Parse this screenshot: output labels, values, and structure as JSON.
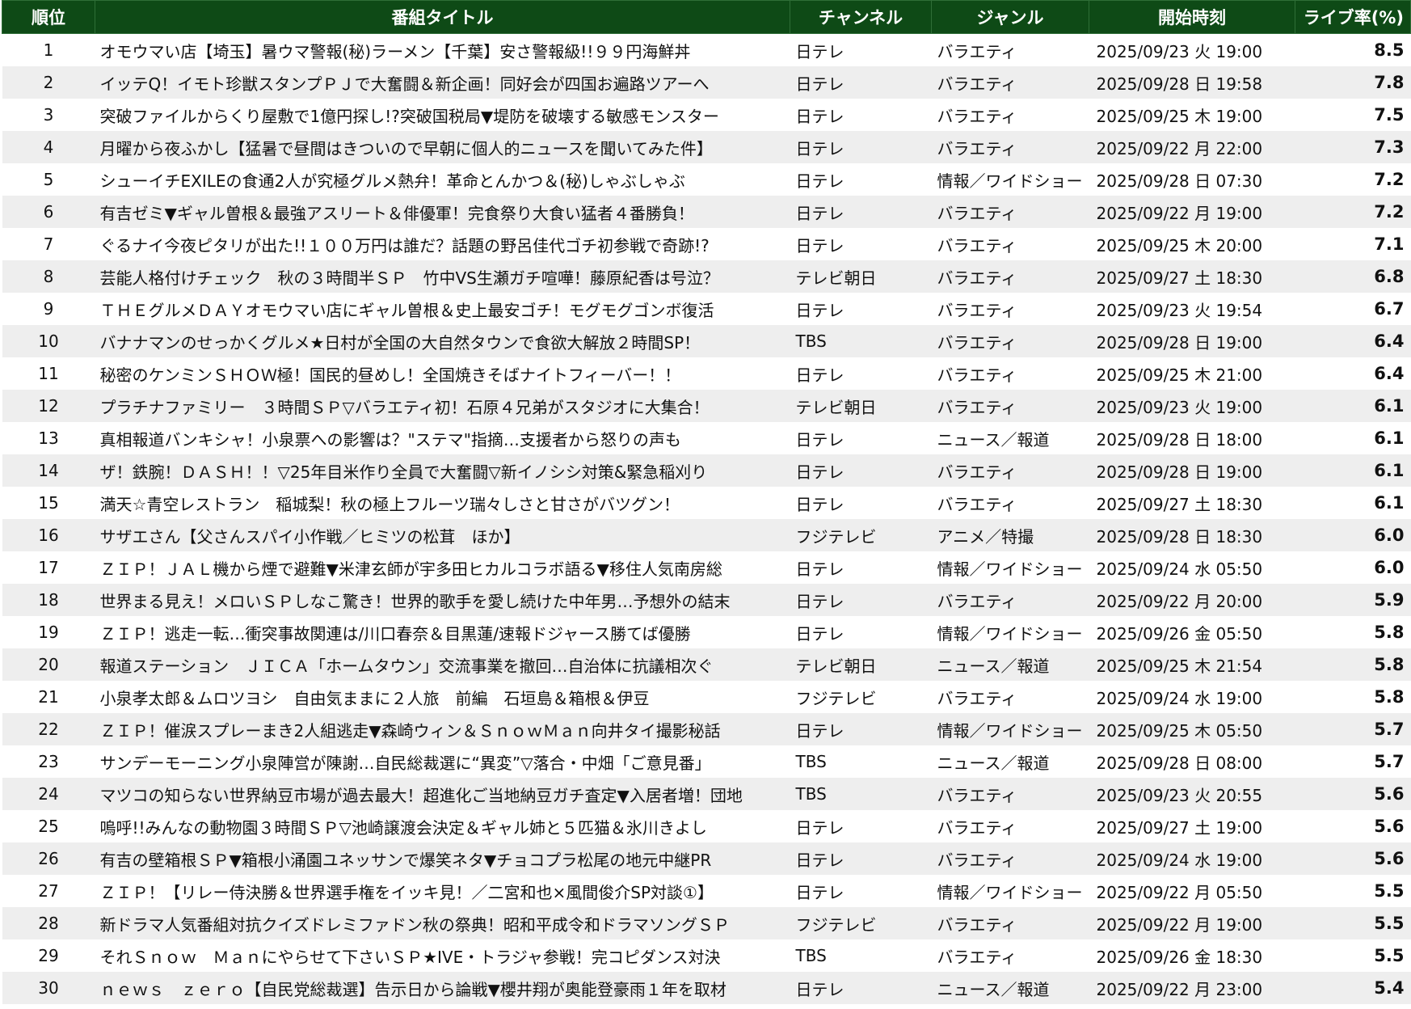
{
  "headers": {
    "rank": "順位",
    "title": "番組タイトル",
    "channel": "チャンネル",
    "genre": "ジャンル",
    "start": "開始時刻",
    "rate": "ライブ率(%)"
  },
  "colors": {
    "header_bg": "#0e4a16",
    "header_text": "#ffffff",
    "stripe": "#eeeeee"
  },
  "rows": [
    {
      "rank": "1",
      "title": "オモウマい店【埼玉】暑ウマ警報(秘)ラーメン【千葉】安さ警報級!!９９円海鮮丼",
      "channel": "日テレ",
      "genre": "バラエティ",
      "start": "2025/09/23 火 19:00",
      "rate": "8.5"
    },
    {
      "rank": "2",
      "title": "イッテQ！イモト珍獣スタンプＰＪで大奮闘＆新企画！同好会が四国お遍路ツアーへ",
      "channel": "日テレ",
      "genre": "バラエティ",
      "start": "2025/09/28 日 19:58",
      "rate": "7.8"
    },
    {
      "rank": "3",
      "title": "突破ファイルからくり屋敷で1億円探し!?突破国税局▼堤防を破壊する敏感モンスター",
      "channel": "日テレ",
      "genre": "バラエティ",
      "start": "2025/09/25 木 19:00",
      "rate": "7.5"
    },
    {
      "rank": "4",
      "title": "月曜から夜ふかし【猛暑で昼間はきついので早朝に個人的ニュースを聞いてみた件】",
      "channel": "日テレ",
      "genre": "バラエティ",
      "start": "2025/09/22 月 22:00",
      "rate": "7.3"
    },
    {
      "rank": "5",
      "title": "シューイチEXILEの食通2人が究極グルメ熱弁！革命とんかつ＆(秘)しゃぶしゃぶ",
      "channel": "日テレ",
      "genre": "情報／ワイドショー",
      "start": "2025/09/28 日 07:30",
      "rate": "7.2"
    },
    {
      "rank": "6",
      "title": "有吉ゼミ▼ギャル曽根＆最強アスリート＆俳優軍！完食祭り大食い猛者４番勝負！",
      "channel": "日テレ",
      "genre": "バラエティ",
      "start": "2025/09/22 月 19:00",
      "rate": "7.2"
    },
    {
      "rank": "7",
      "title": "ぐるナイ今夜ピタリが出た!!１００万円は誰だ？話題の野呂佳代ゴチ初参戦で奇跡!?",
      "channel": "日テレ",
      "genre": "バラエティ",
      "start": "2025/09/25 木 20:00",
      "rate": "7.1"
    },
    {
      "rank": "8",
      "title": "芸能人格付けチェック　秋の３時間半ＳＰ　竹中VS生瀬ガチ喧嘩！藤原紀香は号泣？",
      "channel": "テレビ朝日",
      "genre": "バラエティ",
      "start": "2025/09/27 土 18:30",
      "rate": "6.8"
    },
    {
      "rank": "9",
      "title": "ＴＨＥグルメＤＡＹオモウマい店にギャル曽根＆史上最安ゴチ！モグモグゴンボ復活",
      "channel": "日テレ",
      "genre": "バラエティ",
      "start": "2025/09/23 火 19:54",
      "rate": "6.7"
    },
    {
      "rank": "10",
      "title": "バナナマンのせっかくグルメ★日村が全国の大自然タウンで食欲大解放２時間SP！",
      "channel": "TBS",
      "genre": "バラエティ",
      "start": "2025/09/28 日 19:00",
      "rate": "6.4"
    },
    {
      "rank": "11",
      "title": "秘密のケンミンＳＨＯＷ極！国民的昼めし！全国焼きそばナイトフィーバー！！",
      "channel": "日テレ",
      "genre": "バラエティ",
      "start": "2025/09/25 木 21:00",
      "rate": "6.4"
    },
    {
      "rank": "12",
      "title": "プラチナファミリー　３時間ＳＰ▽バラエティ初！石原４兄弟がスタジオに大集合！",
      "channel": "テレビ朝日",
      "genre": "バラエティ",
      "start": "2025/09/23 火 19:00",
      "rate": "6.1"
    },
    {
      "rank": "13",
      "title": "真相報道バンキシャ！小泉票への影響は？\"ステマ\"指摘…支援者から怒りの声も",
      "channel": "日テレ",
      "genre": "ニュース／報道",
      "start": "2025/09/28 日 18:00",
      "rate": "6.1"
    },
    {
      "rank": "14",
      "title": "ザ！鉄腕！ＤＡＳＨ！！▽25年目米作り全員で大奮闘▽新イノシシ対策&緊急稲刈り",
      "channel": "日テレ",
      "genre": "バラエティ",
      "start": "2025/09/28 日 19:00",
      "rate": "6.1"
    },
    {
      "rank": "15",
      "title": "満天☆青空レストラン　稲城梨！秋の極上フルーツ瑞々しさと甘さがバツグン！",
      "channel": "日テレ",
      "genre": "バラエティ",
      "start": "2025/09/27 土 18:30",
      "rate": "6.1"
    },
    {
      "rank": "16",
      "title": "サザエさん【父さんスパイ小作戦／ヒミツの松茸　ほか】",
      "channel": "フジテレビ",
      "genre": "アニメ／特撮",
      "start": "2025/09/28 日 18:30",
      "rate": "6.0"
    },
    {
      "rank": "17",
      "title": "ＺＩＰ！ＪＡＬ機から煙で避難▼米津玄師が宇多田ヒカルコラボ語る▼移住人気南房総",
      "channel": "日テレ",
      "genre": "情報／ワイドショー",
      "start": "2025/09/24 水 05:50",
      "rate": "6.0"
    },
    {
      "rank": "18",
      "title": "世界まる見え！メロいＳＰしなこ驚き！世界的歌手を愛し続けた中年男…予想外の結末",
      "channel": "日テレ",
      "genre": "バラエティ",
      "start": "2025/09/22 月 20:00",
      "rate": "5.9"
    },
    {
      "rank": "19",
      "title": "ＺＩＰ！逃走一転…衝突事故関連は/川口春奈＆目黒蓮/速報ドジャース勝てば優勝",
      "channel": "日テレ",
      "genre": "情報／ワイドショー",
      "start": "2025/09/26 金 05:50",
      "rate": "5.8"
    },
    {
      "rank": "20",
      "title": "報道ステーション　ＪＩＣＡ「ホームタウン」交流事業を撤回…自治体に抗議相次ぐ",
      "channel": "テレビ朝日",
      "genre": "ニュース／報道",
      "start": "2025/09/25 木 21:54",
      "rate": "5.8"
    },
    {
      "rank": "21",
      "title": "小泉孝太郎＆ムロツヨシ　自由気ままに２人旅　前編　石垣島＆箱根＆伊豆",
      "channel": "フジテレビ",
      "genre": "バラエティ",
      "start": "2025/09/24 水 19:00",
      "rate": "5.8"
    },
    {
      "rank": "22",
      "title": "ＺＩＰ！催涙スプレーまき2人組逃走▼森崎ウィン＆ＳｎｏｗＭａｎ向井タイ撮影秘話",
      "channel": "日テレ",
      "genre": "情報／ワイドショー",
      "start": "2025/09/25 木 05:50",
      "rate": "5.7"
    },
    {
      "rank": "23",
      "title": "サンデーモーニング小泉陣営が陳謝…自民総裁選に“異変”▽落合・中畑「ご意見番」",
      "channel": "TBS",
      "genre": "ニュース／報道",
      "start": "2025/09/28 日 08:00",
      "rate": "5.7"
    },
    {
      "rank": "24",
      "title": "マツコの知らない世界納豆市場が過去最大！超進化ご当地納豆ガチ査定▼入居者増！団地",
      "channel": "TBS",
      "genre": "バラエティ",
      "start": "2025/09/23 火 20:55",
      "rate": "5.6"
    },
    {
      "rank": "25",
      "title": "嗚呼!!みんなの動物園３時間ＳＰ▽池崎譲渡会決定＆ギャル姉と５匹猫＆氷川きよし",
      "channel": "日テレ",
      "genre": "バラエティ",
      "start": "2025/09/27 土 19:00",
      "rate": "5.6"
    },
    {
      "rank": "26",
      "title": "有吉の壁箱根ＳＰ▼箱根小涌園ユネッサンで爆笑ネタ▼チョコプラ松尾の地元中継PR",
      "channel": "日テレ",
      "genre": "バラエティ",
      "start": "2025/09/24 水 19:00",
      "rate": "5.6"
    },
    {
      "rank": "27",
      "title": "ＺＩＰ！【リレー侍決勝＆世界選手権をイッキ見！／二宮和也×風間俊介SP対談①】",
      "channel": "日テレ",
      "genre": "情報／ワイドショー",
      "start": "2025/09/22 月 05:50",
      "rate": "5.5"
    },
    {
      "rank": "28",
      "title": "新ドラマ人気番組対抗クイズドレミファドン秋の祭典！昭和平成令和ドラマソングＳＰ",
      "channel": "フジテレビ",
      "genre": "バラエティ",
      "start": "2025/09/22 月 19:00",
      "rate": "5.5"
    },
    {
      "rank": "29",
      "title": "それＳｎｏｗ　Ｍａｎにやらせて下さいＳＰ★IVE・トラジャ参戦！完コピダンス対決",
      "channel": "TBS",
      "genre": "バラエティ",
      "start": "2025/09/26 金 18:30",
      "rate": "5.5"
    },
    {
      "rank": "30",
      "title": "ｎｅｗｓ　ｚｅｒｏ【自民党総裁選】告示日から論戦▼櫻井翔が奥能登豪雨１年を取材",
      "channel": "日テレ",
      "genre": "ニュース／報道",
      "start": "2025/09/22 月 23:00",
      "rate": "5.4"
    }
  ]
}
